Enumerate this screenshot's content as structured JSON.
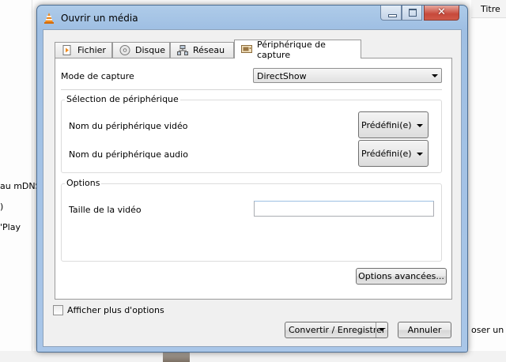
{
  "background": {
    "header_title": "Titre",
    "list_items": [
      "au mDNS",
      ")",
      "'Play"
    ],
    "right_text": "oser un"
  },
  "dialog": {
    "title": "Ouvrir un média",
    "tabs": [
      {
        "label": "Fichier",
        "icon": "file-icon"
      },
      {
        "label": "Disque",
        "icon": "disc-icon"
      },
      {
        "label": "Réseau",
        "icon": "network-icon"
      },
      {
        "label": "Périphérique de capture",
        "icon": "capture-device-icon",
        "active": true
      }
    ],
    "capture_mode": {
      "label": "Mode de capture",
      "value": "DirectShow"
    },
    "device_group": {
      "title": "Sélection de périphérique",
      "video_label": "Nom du périphérique vidéo",
      "video_value": "Prédéfini(e)",
      "audio_label": "Nom du périphérique audio",
      "audio_value": "Prédéfini(e)"
    },
    "options_group": {
      "title": "Options",
      "video_size_label": "Taille de la vidéo",
      "video_size_value": ""
    },
    "advanced_button": "Options avancées...",
    "show_more": {
      "label": "Afficher plus d'options",
      "checked": false
    },
    "convert_button": "Convertir / Enregistrer",
    "cancel_button": "Annuler"
  },
  "colors": {
    "title_bar": "#a9c6e8",
    "close_button": "#c7493b",
    "vlc_orange": "#f08a1c"
  }
}
